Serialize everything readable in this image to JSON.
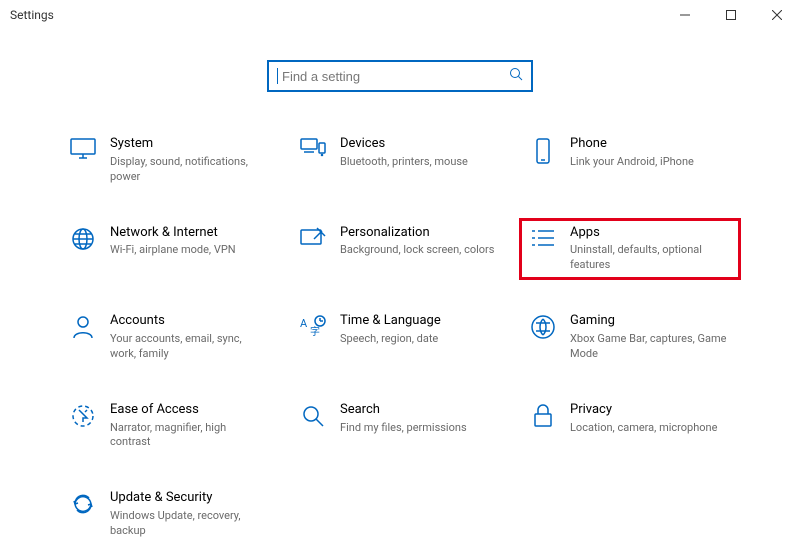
{
  "window": {
    "title": "Settings"
  },
  "search": {
    "placeholder": "Find a setting"
  },
  "tiles": {
    "system": {
      "title": "System",
      "sub": "Display, sound, notifications, power"
    },
    "devices": {
      "title": "Devices",
      "sub": "Bluetooth, printers, mouse"
    },
    "phone": {
      "title": "Phone",
      "sub": "Link your Android, iPhone"
    },
    "network": {
      "title": "Network & Internet",
      "sub": "Wi-Fi, airplane mode, VPN"
    },
    "personal": {
      "title": "Personalization",
      "sub": "Background, lock screen, colors"
    },
    "apps": {
      "title": "Apps",
      "sub": "Uninstall, defaults, optional features"
    },
    "accounts": {
      "title": "Accounts",
      "sub": "Your accounts, email, sync, work, family"
    },
    "time": {
      "title": "Time & Language",
      "sub": "Speech, region, date"
    },
    "gaming": {
      "title": "Gaming",
      "sub": "Xbox Game Bar, captures, Game Mode"
    },
    "ease": {
      "title": "Ease of Access",
      "sub": "Narrator, magnifier, high contrast"
    },
    "searchT": {
      "title": "Search",
      "sub": "Find my files, permissions"
    },
    "privacy": {
      "title": "Privacy",
      "sub": "Location, camera, microphone"
    },
    "update": {
      "title": "Update & Security",
      "sub": "Windows Update, recovery, backup"
    }
  }
}
